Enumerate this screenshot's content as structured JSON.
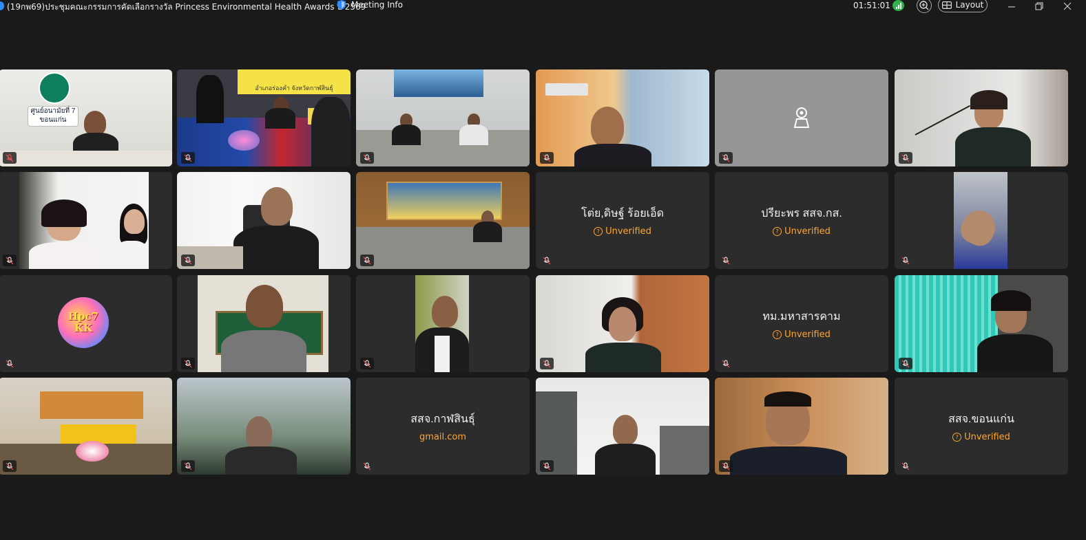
{
  "window": {
    "title": "(19กพ69)ประชุมคณะกรรมการคัดเลือกรางวัล Princess Environmental Health Awards ปี 2569",
    "meeting_info": "Meeting Info",
    "timer": "01:51:01",
    "layout_label": "Layout",
    "icons": [
      "shield-icon",
      "signal-icon",
      "zoom-icon",
      "layout-icon",
      "minimize-icon",
      "restore-icon",
      "close-icon"
    ]
  },
  "tiles": [
    {
      "name": "",
      "status": "",
      "video": true,
      "sign_text": "ศูนย์อนามัยที่ 7\nขอนแก่น"
    },
    {
      "name": "",
      "status": "",
      "video": true,
      "banner_text": "อำเภอร่องคำ จังหวัดกาฬสินธุ์"
    },
    {
      "name": "",
      "status": "",
      "video": true
    },
    {
      "name": "",
      "status": "",
      "video": true
    },
    {
      "name": "",
      "status": "",
      "video": false,
      "camera_off": true
    },
    {
      "name": "",
      "status": "",
      "video": true
    },
    {
      "name": "",
      "status": "",
      "video": true
    },
    {
      "name": "",
      "status": "",
      "video": true
    },
    {
      "name": "",
      "status": "",
      "video": true
    },
    {
      "name": "โต่ย,ดิษฐ์ ร้อยเอ็ด",
      "status": "Unverified",
      "video": false
    },
    {
      "name": "ปรียะพร สสจ.กส.",
      "status": "Unverified",
      "video": false
    },
    {
      "name": "",
      "status": "",
      "video": true
    },
    {
      "name": "",
      "status": "",
      "video": false,
      "avatar_text": "Hpc7\nKK"
    },
    {
      "name": "",
      "status": "",
      "video": true
    },
    {
      "name": "",
      "status": "",
      "video": true
    },
    {
      "name": "",
      "status": "",
      "video": true
    },
    {
      "name": "ทม.มหาสารคาม",
      "status": "Unverified",
      "video": false
    },
    {
      "name": "",
      "status": "",
      "video": true
    },
    {
      "name": "",
      "status": "",
      "video": true
    },
    {
      "name": "",
      "status": "",
      "video": true
    },
    {
      "name": "สสจ.กาฬสินธุ์",
      "status": "gmail.com",
      "video": false
    },
    {
      "name": "",
      "status": "",
      "video": true
    },
    {
      "name": "",
      "status": "",
      "video": true
    },
    {
      "name": "สสจ.ขอนแก่น",
      "status": "Unverified",
      "video": false
    }
  ],
  "colors": {
    "background": "#1a1a1a",
    "tile": "#2c2c2c",
    "unverified": "#ffa630",
    "signal": "#33b14a",
    "accent": "#2d8cff"
  }
}
